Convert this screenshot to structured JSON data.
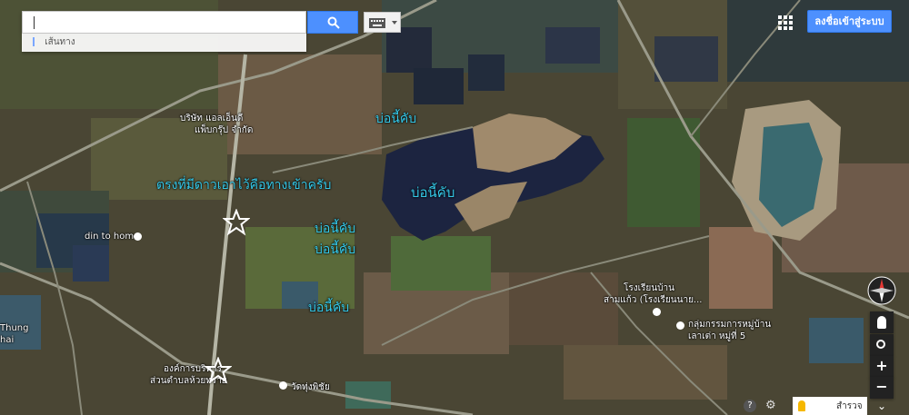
{
  "search": {
    "value": "",
    "placeholder": ""
  },
  "directions_label": "เส้นทาง",
  "signin_label": "ลงชื่อเข้าสู่ระบบ",
  "annotations": {
    "entrance": "ตรงที่มีดาวเอาไว้คือทางเข้าครับ",
    "pond_top": "บ่อนี้คับ",
    "pond_center": "บ่อนี้คับ",
    "pond_left1": "บ่อนี้คับ",
    "pond_left2": "บ่อนี้คับ",
    "pond_bottom": "บ่อนี้คับ"
  },
  "places": {
    "company": "บริษัท แอลเอ็นดี",
    "company2": "แพ็บกรุ๊ป จำกัด",
    "dintohome": "din to home",
    "school1": "โรงเรียนบ้าน",
    "school2": "สามแก้ว (โรงเรียนนาย...",
    "group1": "กลุ่มกรรมการหมู่บ้าน",
    "group2": "เลาเต่า หมู่ที่ 5",
    "org1": "องค์การบริหาร",
    "org2": "ส่วนตำบลห้วยทราย",
    "temple": "วัดทุ่งพิชัย",
    "thung1": "Thung",
    "thung2": "hai"
  },
  "bottom": {
    "explore_label": "สำรวจ"
  },
  "icons": {
    "search": "search-icon",
    "keyboard": "keyboard-icon",
    "apps": "apps-grid-icon",
    "compass": "compass-icon",
    "zoom_in": "zoom-in-icon",
    "zoom_out": "zoom-out-icon",
    "my_location": "my-location-icon",
    "pegman": "pegman-icon",
    "help": "help-icon",
    "settings": "gear-icon",
    "star": "star-marker-icon"
  },
  "colors": {
    "accent": "#4d90fe",
    "water_label": "#35c8e8"
  }
}
